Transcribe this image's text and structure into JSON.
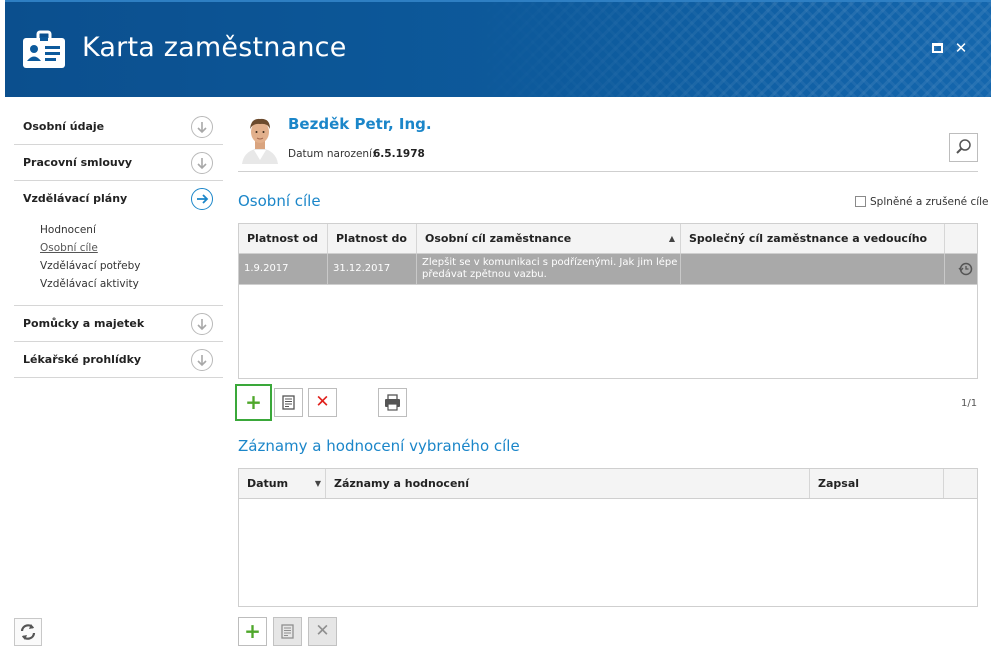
{
  "window": {
    "title": "Karta zaměstnance"
  },
  "colors": {
    "header": "#0d5a9c",
    "accent": "#1b86c9",
    "selected_row": "#a9a9a9",
    "add_green": "#4fa72b",
    "delete_red": "#e0201b"
  },
  "sidebar": {
    "sections": [
      {
        "label": "Osobní údaje",
        "icon": "arrow-down-circle-icon"
      },
      {
        "label": "Pracovní smlouvy",
        "icon": "arrow-down-circle-icon"
      },
      {
        "label": "Vzdělávací plány",
        "icon": "arrow-right-circle-icon",
        "active": true
      },
      {
        "label": "Pomůcky a majetek",
        "icon": "arrow-down-circle-icon"
      },
      {
        "label": "Lékařské prohlídky",
        "icon": "arrow-down-circle-icon"
      }
    ],
    "sub_items": [
      "Hodnocení",
      "Osobní cíle",
      "Vzdělávací potřeby",
      "Vzdělávací aktivity"
    ],
    "active_sub_item": "Osobní cíle"
  },
  "employee": {
    "name": "Bezděk Petr, Ing.",
    "dob_label": "Datum narození:",
    "dob_value": "6.5.1978"
  },
  "goals": {
    "title": "Osobní cíle",
    "filter_label": "Splněné a zrušené cíle",
    "filter_checked": false,
    "columns": [
      "Platnost od",
      "Platnost do",
      "Osobní cíl zaměstnance",
      "Společný cíl zaměstnance a vedoucího"
    ],
    "sorted_column": "Osobní cíl zaměstnance",
    "rows": [
      {
        "from": "1.9.2017",
        "to": "31.12.2017",
        "goal_line1": "Zlepšit se v komunikaci s podřízenými. Jak jim lépe",
        "goal_line2": "předávat zpětnou vazbu.",
        "shared": "",
        "icon": "history-icon"
      }
    ],
    "pager": "1/1"
  },
  "records": {
    "title": "Záznamy a hodnocení vybraného cíle",
    "columns": [
      "Datum",
      "Záznamy a hodnocení",
      "Zapsal"
    ],
    "rows": []
  }
}
